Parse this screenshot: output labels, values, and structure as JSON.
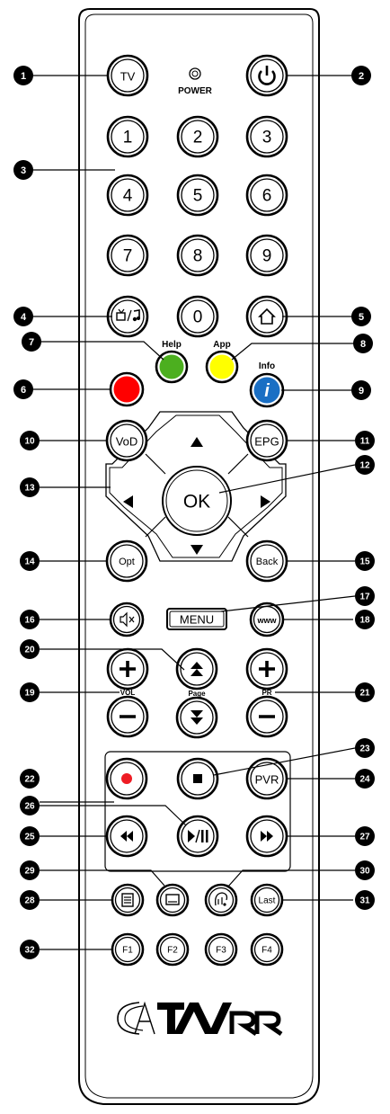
{
  "remote": {
    "power_label": "POWER",
    "brand_logo": "CATVARR"
  },
  "buttons": {
    "tv": "TV",
    "n1": "1",
    "n2": "2",
    "n3": "3",
    "n4": "4",
    "n5": "5",
    "n6": "6",
    "n7": "7",
    "n8": "8",
    "n9": "9",
    "n0": "0",
    "vod": "VoD",
    "epg": "EPG",
    "ok": "OK",
    "opt": "Opt",
    "back": "Back",
    "menu": "MENU",
    "www": "www",
    "pvr": "PVR",
    "last": "Last",
    "f1": "F1",
    "f2": "F2",
    "f3": "F3",
    "f4": "F4"
  },
  "labels": {
    "help": "Help",
    "app": "App",
    "info": "Info",
    "vol": "VOL",
    "page": "Page",
    "pr": "PR"
  },
  "colors": {
    "red": "#ff0000",
    "green": "#4caf1f",
    "yellow": "#ffff00",
    "blue": "#1a6fc4",
    "record_dot": "#ee1c24"
  },
  "callouts": [
    "1",
    "2",
    "3",
    "4",
    "5",
    "6",
    "7",
    "8",
    "9",
    "10",
    "11",
    "12",
    "13",
    "14",
    "15",
    "16",
    "17",
    "18",
    "19",
    "20",
    "21",
    "22",
    "23",
    "24",
    "25",
    "26",
    "27",
    "28",
    "29",
    "30",
    "31",
    "32"
  ]
}
